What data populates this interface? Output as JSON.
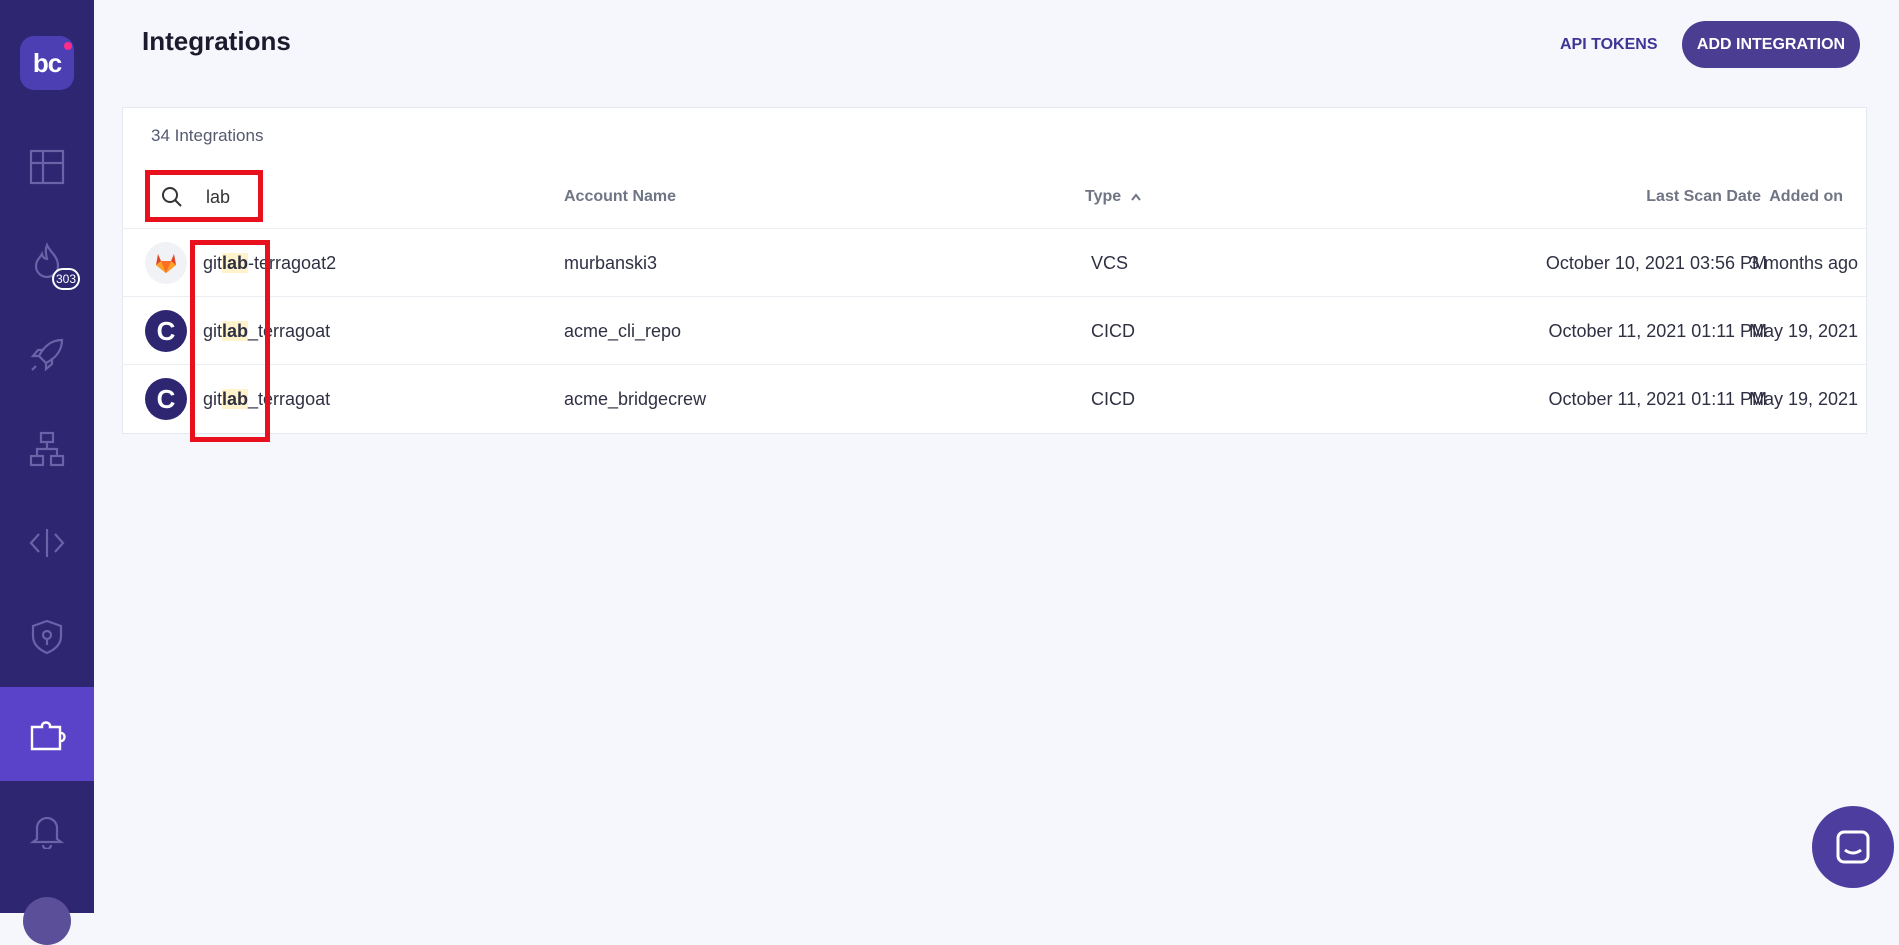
{
  "sidebar": {
    "logo_text": "bc",
    "items": [
      {
        "name": "dashboard-icon"
      },
      {
        "name": "incidents-icon",
        "badge": "303"
      },
      {
        "name": "rocket-icon"
      },
      {
        "name": "inventory-icon"
      },
      {
        "name": "code-icon"
      },
      {
        "name": "shield-icon"
      },
      {
        "name": "puzzle-icon",
        "active": true
      },
      {
        "name": "bell-icon"
      }
    ],
    "accent": "#2e2670",
    "active_color": "#5a43c8"
  },
  "header": {
    "title": "Integrations",
    "api_tokens_label": "API TOKENS",
    "add_integration_label": "ADD INTEGRATION"
  },
  "table": {
    "count_label": "34 Integrations",
    "search_value": "lab",
    "columns": {
      "account_name": "Account Name",
      "type": "Type",
      "last_scan_date": "Last Scan Date",
      "added_on": "Added on"
    },
    "rows": [
      {
        "icon": "gitlab-icon",
        "name_pre": "git",
        "name_hl": "lab",
        "name_post": "-terragoat2",
        "account": "murbanski3",
        "type": "VCS",
        "last_scan": "October 10, 2021 03:56 PM",
        "added": "3 months ago"
      },
      {
        "icon": "circleci-icon",
        "icon_letter": "C",
        "name_pre": "git",
        "name_hl": "lab",
        "name_post": "_terragoat",
        "account": "acme_cli_repo",
        "type": "CICD",
        "last_scan": "October 11, 2021 01:11 PM",
        "added": "May 19, 2021"
      },
      {
        "icon": "circleci-icon",
        "icon_letter": "C",
        "name_pre": "git",
        "name_hl": "lab",
        "name_post": "_terragoat",
        "account": "acme_bridgecrew",
        "type": "CICD",
        "last_scan": "October 11, 2021 01:11 PM",
        "added": "May 19, 2021"
      }
    ]
  },
  "colors": {
    "primary": "#4b3e92",
    "annotation_red": "#e8101c",
    "highlight": "#fff3cc"
  }
}
